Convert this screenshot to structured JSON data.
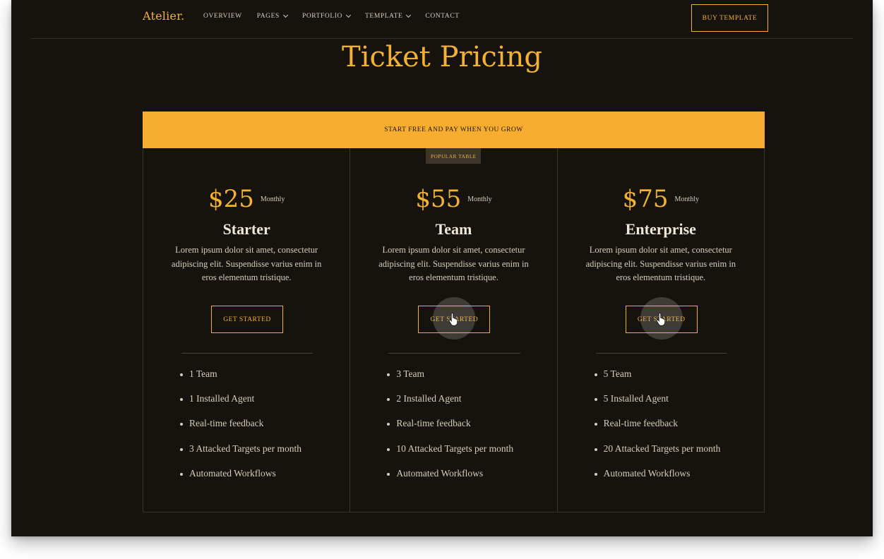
{
  "nav": {
    "logo": "Atelier.",
    "items": [
      {
        "label": "OVERVIEW",
        "has_dropdown": false
      },
      {
        "label": "PAGES",
        "has_dropdown": true
      },
      {
        "label": "PORTFOLIO",
        "has_dropdown": true
      },
      {
        "label": "TEMPLATE",
        "has_dropdown": true
      },
      {
        "label": "CONTACT",
        "has_dropdown": false
      }
    ],
    "buy_label": "BUY TEMPLATE"
  },
  "page": {
    "title": "Ticket Pricing",
    "banner": "START FREE AND PAY WHEN YOU GROW"
  },
  "colors": {
    "accent": "#f2b134",
    "banner": "#f7ad2f",
    "background": "#16130f",
    "text": "#d7cdb9"
  },
  "plans": [
    {
      "price": "$25",
      "period": "Monthly",
      "name": "Starter",
      "description": "Lorem ipsum dolor sit amet, consectetur adipiscing elit. Suspendisse varius enim in eros elementum tristique.",
      "cta": "GET STARTED",
      "features": [
        "1 Team",
        "1 Installed Agent",
        "Real-time feedback",
        "3 Attacked Targets per month",
        "Automated Workflows"
      ]
    },
    {
      "badge": "POPULAR TABLE",
      "price": "$55",
      "period": "Monthly",
      "name": "Team",
      "description": "Lorem ipsum dolor sit amet, consectetur adipiscing elit. Suspendisse varius enim in eros elementum tristique.",
      "cta": "GET STARTED",
      "features": [
        "3 Team",
        "2 Installed Agent",
        "Real-time feedback",
        "10 Attacked Targets per month",
        "Automated Workflows"
      ]
    },
    {
      "price": "$75",
      "period": "Monthly",
      "name": "Enterprise",
      "description": "Lorem ipsum dolor sit amet, consectetur adipiscing elit. Suspendisse varius enim in eros elementum tristique.",
      "cta": "GET STARTED",
      "features": [
        "5 Team",
        "5 Installed Agent",
        "Real-time feedback",
        "20 Attacked Targets per month",
        "Automated Workflows"
      ]
    }
  ]
}
